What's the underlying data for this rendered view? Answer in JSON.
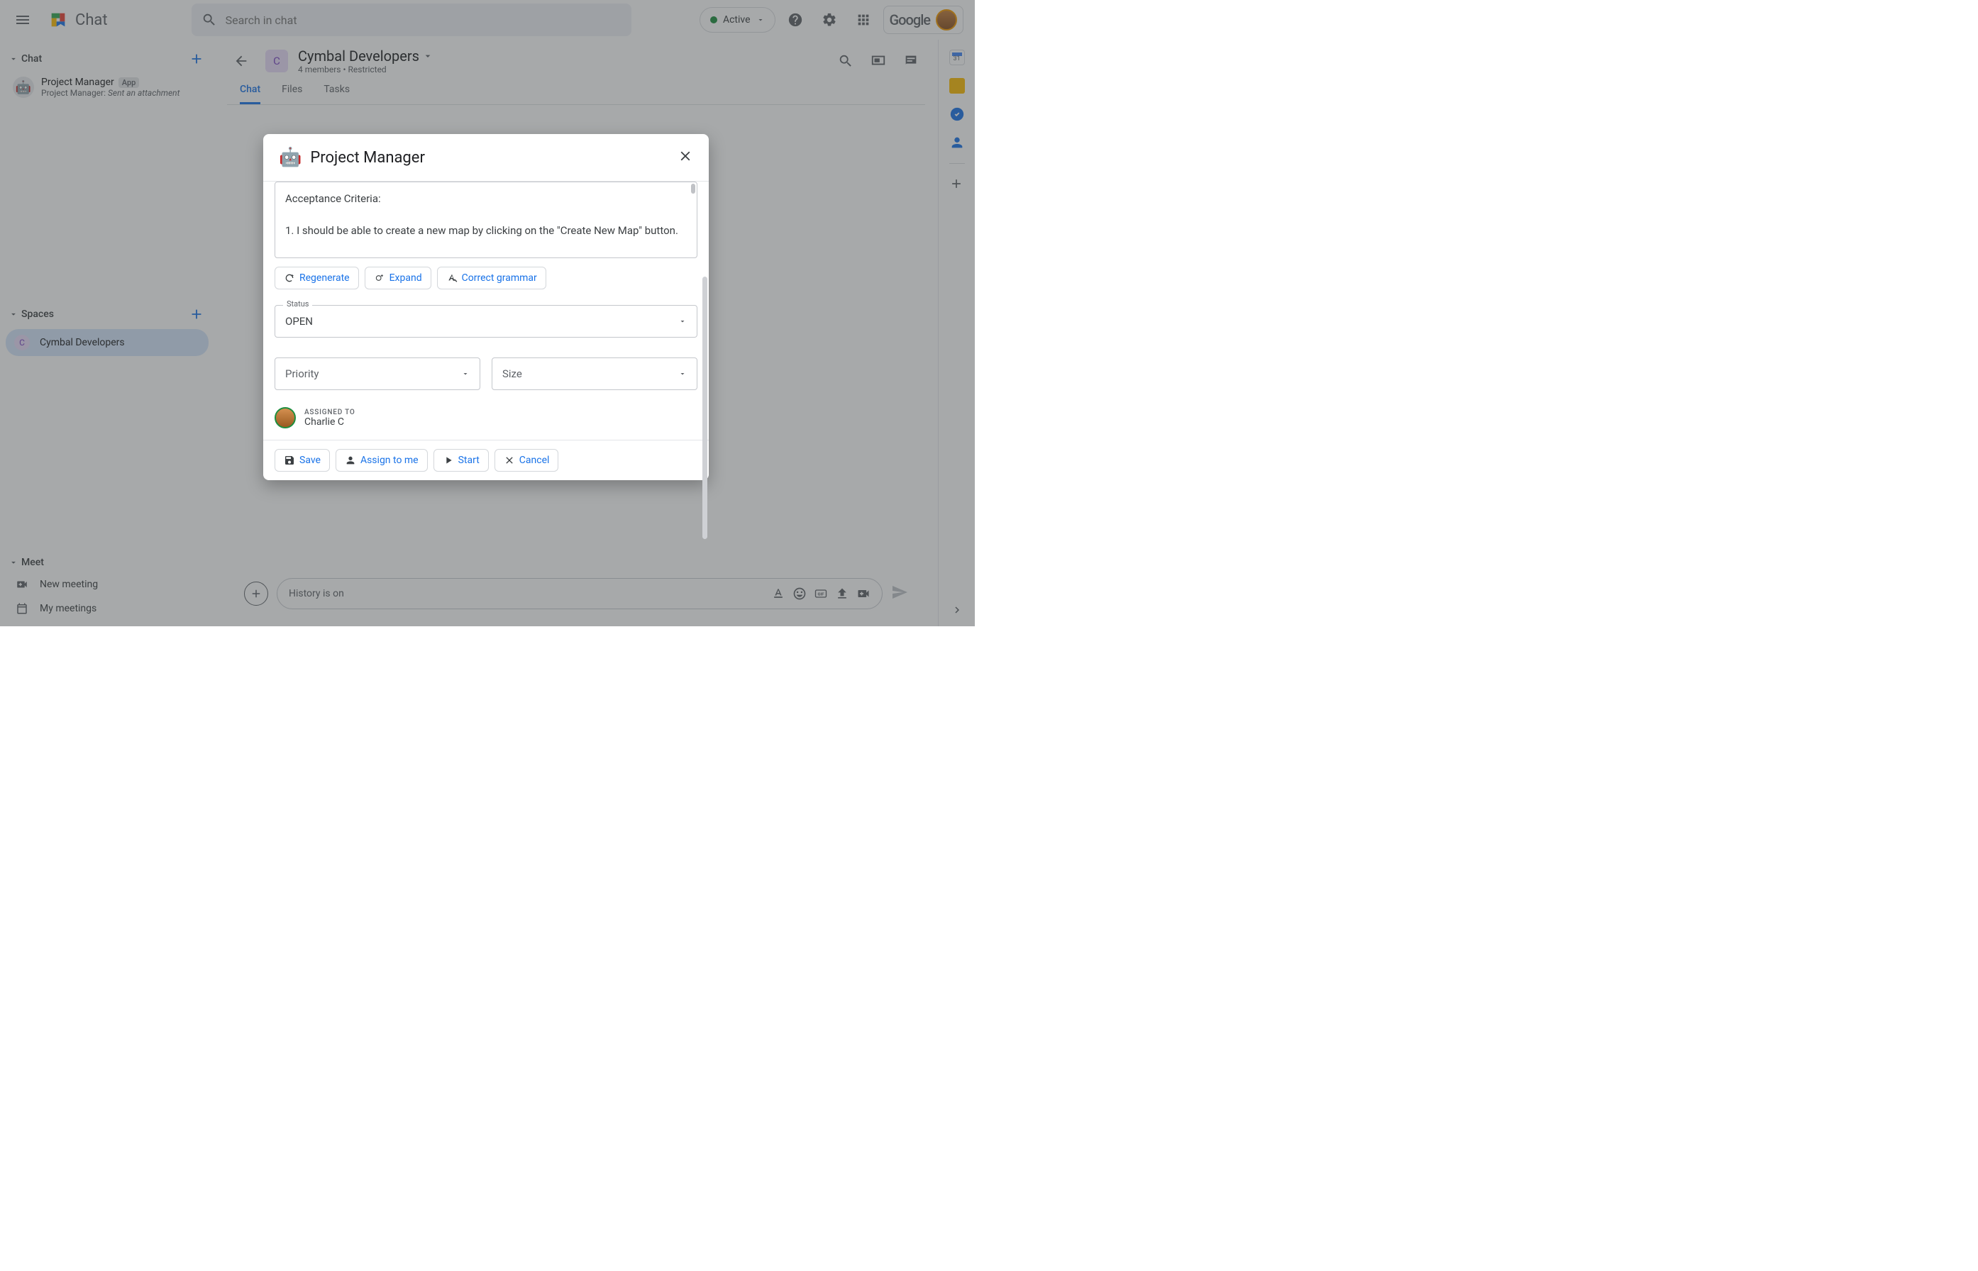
{
  "topbar": {
    "product": "Chat",
    "search_placeholder": "Search in chat",
    "status_label": "Active",
    "brand": "Google"
  },
  "sidebar": {
    "sections": {
      "chat": {
        "label": "Chat"
      },
      "spaces": {
        "label": "Spaces"
      },
      "meet": {
        "label": "Meet"
      }
    },
    "chat_item": {
      "title": "Project Manager",
      "badge": "App",
      "prefix": "Project Manager: ",
      "preview": "Sent an attachment"
    },
    "space_item": {
      "initial": "C",
      "name": "Cymbal Developers"
    },
    "meet": {
      "new": "New meeting",
      "my": "My meetings"
    }
  },
  "main": {
    "space": {
      "initial": "C",
      "title": "Cymbal Developers",
      "subtitle": "4 members  •  Restricted"
    },
    "tabs": {
      "chat": "Chat",
      "files": "Files",
      "tasks": "Tasks"
    },
    "compose_placeholder": "History is on"
  },
  "dialog": {
    "title": "Project Manager",
    "description_h": "Acceptance Criteria:",
    "description_body": "1. I should be able to create a new map by clicking on the \"Create New Map\" button.",
    "chips": {
      "regenerate": "Regenerate",
      "expand": "Expand",
      "grammar": "Correct grammar"
    },
    "status": {
      "label": "Status",
      "value": "OPEN"
    },
    "priority_placeholder": "Priority",
    "size_placeholder": "Size",
    "assigned": {
      "label": "ASSIGNED TO",
      "name": "Charlie C"
    },
    "actions": {
      "save": "Save",
      "assign": "Assign to me",
      "start": "Start",
      "cancel": "Cancel"
    }
  }
}
